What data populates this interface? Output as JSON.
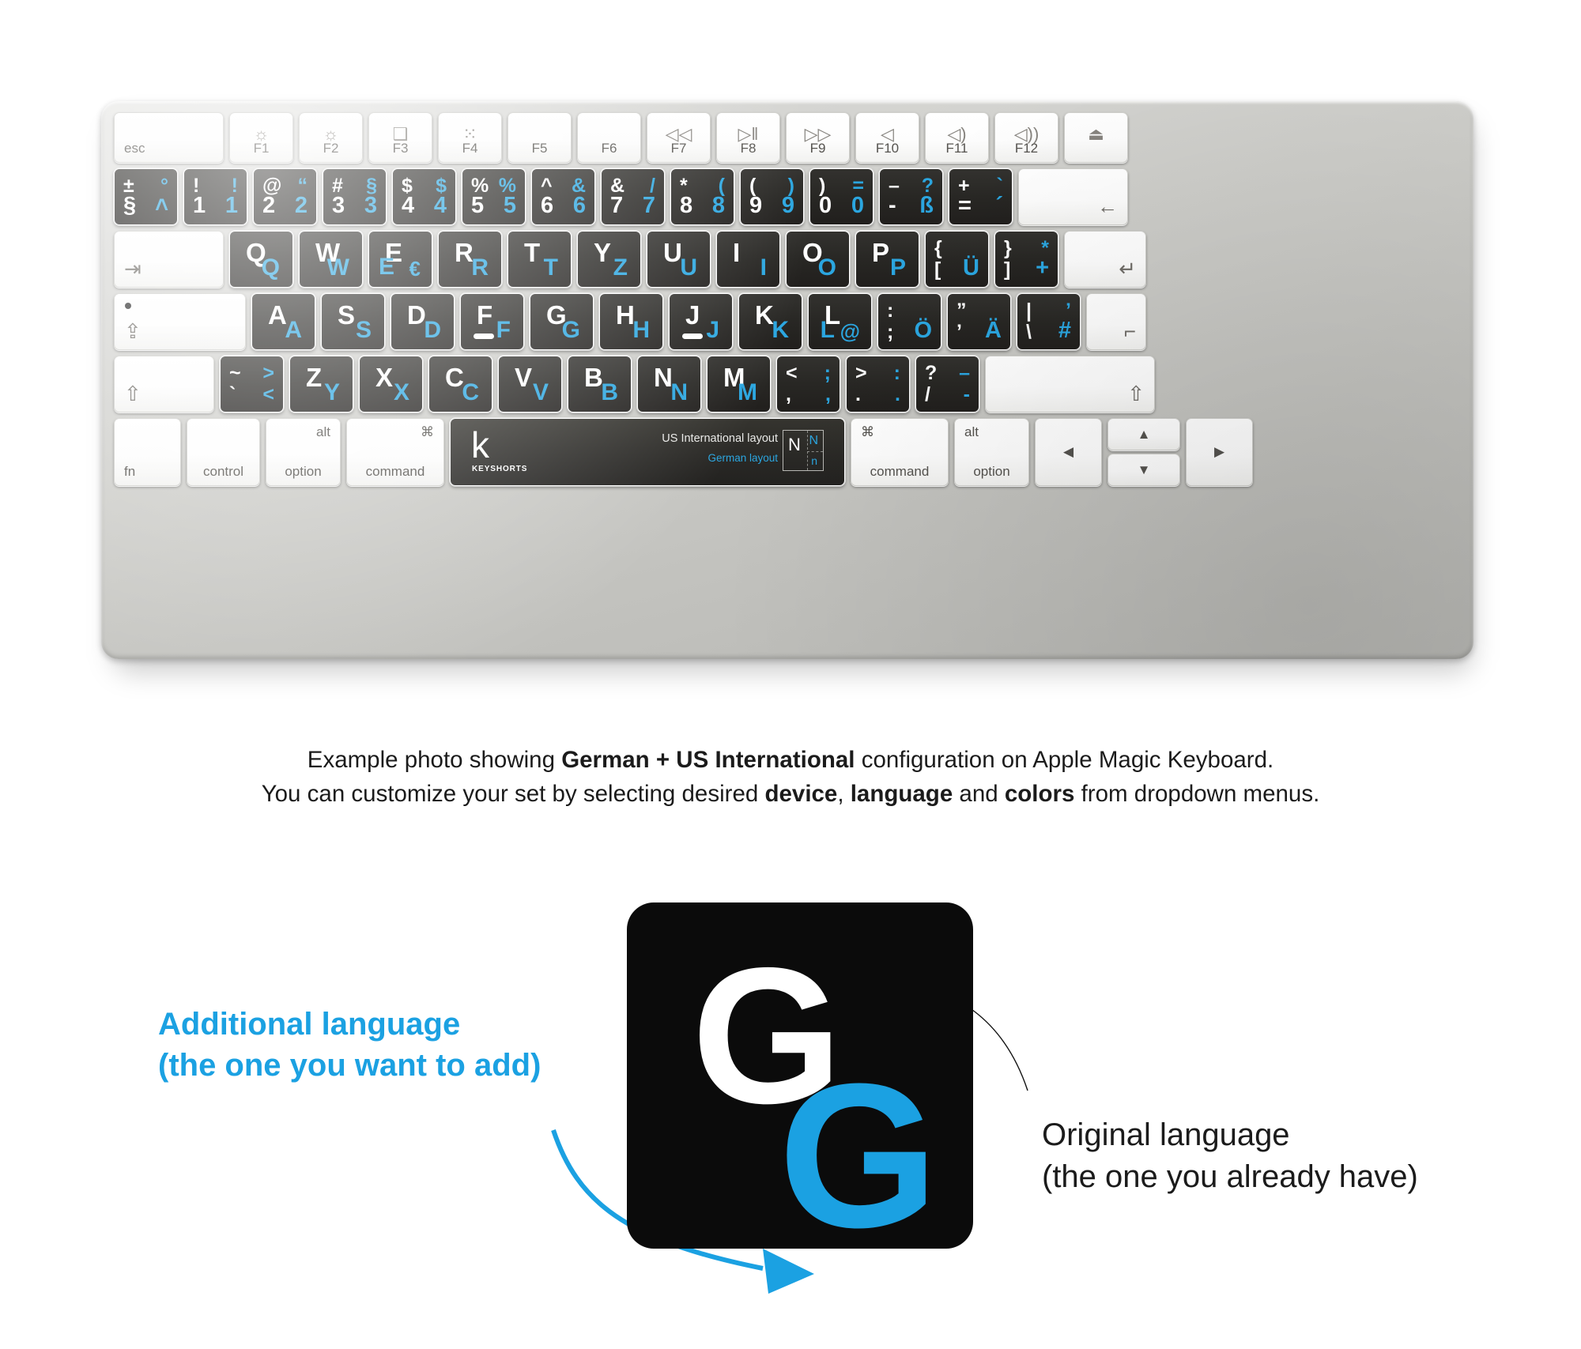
{
  "product": {
    "device": "Apple Magic Keyboard",
    "brand": "KEYSHORTS",
    "brand_mark": "k",
    "spacebar": {
      "primary_layout_label": "US International layout",
      "secondary_layout_label": "German layout",
      "badge": {
        "main": "N",
        "alt_top": "N",
        "alt_bottom": "n"
      }
    },
    "colors": {
      "accent_blue": "#2ba6e0",
      "key_black": "#262522",
      "key_white": "#ffffff",
      "body_silver": "#c9c9c5"
    }
  },
  "keyboard": {
    "function_row": [
      {
        "name": "esc",
        "type": "light",
        "label": "esc",
        "align": "bl",
        "width": 139
      },
      {
        "name": "f1",
        "type": "light",
        "label": "F1",
        "icon": "brightness-down-icon",
        "glyph": "☼"
      },
      {
        "name": "f2",
        "type": "light",
        "label": "F2",
        "icon": "brightness-up-icon",
        "glyph": "☼"
      },
      {
        "name": "f3",
        "type": "light",
        "label": "F3",
        "icon": "mission-control-icon",
        "glyph": "❑"
      },
      {
        "name": "f4",
        "type": "light",
        "label": "F4",
        "icon": "launchpad-icon",
        "glyph": "⁙"
      },
      {
        "name": "f5",
        "type": "light",
        "label": "F5",
        "icon": "none",
        "glyph": ""
      },
      {
        "name": "f6",
        "type": "light",
        "label": "F6",
        "icon": "none",
        "glyph": ""
      },
      {
        "name": "f7",
        "type": "light",
        "label": "F7",
        "icon": "rewind-icon",
        "glyph": "◁◁"
      },
      {
        "name": "f8",
        "type": "light",
        "label": "F8",
        "icon": "play-pause-icon",
        "glyph": "▷‖"
      },
      {
        "name": "f9",
        "type": "light",
        "label": "F9",
        "icon": "fast-forward-icon",
        "glyph": "▷▷"
      },
      {
        "name": "f10",
        "type": "light",
        "label": "F10",
        "icon": "mute-icon",
        "glyph": "◁"
      },
      {
        "name": "f11",
        "type": "light",
        "label": "F11",
        "icon": "volume-down-icon",
        "glyph": "◁)"
      },
      {
        "name": "f12",
        "type": "light",
        "label": "F12",
        "icon": "volume-up-icon",
        "glyph": "◁))"
      },
      {
        "name": "eject",
        "type": "light",
        "label": "",
        "icon": "eject-icon",
        "glyph": "⏏"
      }
    ],
    "number_row": [
      {
        "name": "key-grave",
        "tl": "±",
        "tr": "°",
        "bl": "§",
        "br": "˄"
      },
      {
        "name": "key-1",
        "tl": "!",
        "tr": "!",
        "bl": "1",
        "br": "1"
      },
      {
        "name": "key-2",
        "tl": "@",
        "tr": "“",
        "bl": "2",
        "br": "2"
      },
      {
        "name": "key-3",
        "tl": "#",
        "tr": "§",
        "bl": "3",
        "br": "3"
      },
      {
        "name": "key-4",
        "tl": "$",
        "tr": "$",
        "bl": "4",
        "br": "4"
      },
      {
        "name": "key-5",
        "tl": "%",
        "tr": "%",
        "bl": "5",
        "br": "5"
      },
      {
        "name": "key-6",
        "tl": "^",
        "tr": "&",
        "bl": "6",
        "br": "6"
      },
      {
        "name": "key-7",
        "tl": "&",
        "tr": "/",
        "bl": "7",
        "br": "7"
      },
      {
        "name": "key-8",
        "tl": "*",
        "tr": "(",
        "bl": "8",
        "br": "8"
      },
      {
        "name": "key-9",
        "tl": "(",
        "tr": ")",
        "bl": "9",
        "br": "9"
      },
      {
        "name": "key-0",
        "tl": ")",
        "tr": "=",
        "bl": "0",
        "br": "0"
      },
      {
        "name": "key-minus",
        "tl": "–",
        "tr": "?",
        "bl": "-",
        "br": "ß"
      },
      {
        "name": "key-equals",
        "tl": "+",
        "tr": "`",
        "bl": "=",
        "br": "´"
      },
      {
        "name": "key-delete",
        "type": "light",
        "glyph": "←",
        "align": "br"
      }
    ],
    "qwerty_row": [
      {
        "name": "key-tab",
        "type": "light",
        "glyph": "⇥",
        "align": "bl"
      },
      {
        "name": "key-q",
        "main": "Q",
        "sub": "Q"
      },
      {
        "name": "key-w",
        "main": "W",
        "sub": "W"
      },
      {
        "name": "key-e",
        "main": "E",
        "sub": "E",
        "extra": "€"
      },
      {
        "name": "key-r",
        "main": "R",
        "sub": "R"
      },
      {
        "name": "key-t",
        "main": "T",
        "sub": "T"
      },
      {
        "name": "key-y",
        "main": "Y",
        "sub": "Z"
      },
      {
        "name": "key-u",
        "main": "U",
        "sub": "U"
      },
      {
        "name": "key-i",
        "main": "I",
        "sub": "I"
      },
      {
        "name": "key-o",
        "main": "O",
        "sub": "O"
      },
      {
        "name": "key-p",
        "main": "P",
        "sub": "P"
      },
      {
        "name": "key-lbracket",
        "tl": "{",
        "bl": "[",
        "br": "Ü"
      },
      {
        "name": "key-rbracket",
        "tl": "}",
        "tr": "*",
        "bl": "]",
        "br": "+"
      },
      {
        "name": "key-return",
        "type": "light",
        "glyph": "↵",
        "align": "br"
      }
    ],
    "home_row": [
      {
        "name": "key-capslock",
        "type": "light",
        "glyph": "⇪",
        "align": "bl",
        "dot": true
      },
      {
        "name": "key-a",
        "main": "A",
        "sub": "A"
      },
      {
        "name": "key-s",
        "main": "S",
        "sub": "S"
      },
      {
        "name": "key-d",
        "main": "D",
        "sub": "D"
      },
      {
        "name": "key-f",
        "main": "F",
        "sub": "F",
        "homebar": true
      },
      {
        "name": "key-g",
        "main": "G",
        "sub": "G"
      },
      {
        "name": "key-h",
        "main": "H",
        "sub": "H"
      },
      {
        "name": "key-j",
        "main": "J",
        "sub": "J",
        "homebar": true
      },
      {
        "name": "key-k",
        "main": "K",
        "sub": "K"
      },
      {
        "name": "key-l",
        "main": "L",
        "sub": "L",
        "extra": "@"
      },
      {
        "name": "key-semicolon",
        "tl": ":",
        "bl": ";",
        "br": "Ö"
      },
      {
        "name": "key-quote",
        "tl": "”",
        "bl": "’",
        "br": "Ä"
      },
      {
        "name": "key-backslash",
        "tl": "|",
        "tr": "’",
        "bl": "\\",
        "br": "#"
      },
      {
        "name": "key-return-lower",
        "type": "light",
        "glyph": "⌐",
        "align": "br"
      }
    ],
    "bottom_letter_row": [
      {
        "name": "key-lshift",
        "type": "light",
        "glyph": "⇧",
        "align": "bl"
      },
      {
        "name": "key-section",
        "tl": "~",
        "tr": ">",
        "bl": "`",
        "br": "<"
      },
      {
        "name": "key-z",
        "main": "Z",
        "sub": "Y"
      },
      {
        "name": "key-x",
        "main": "X",
        "sub": "X"
      },
      {
        "name": "key-c",
        "main": "C",
        "sub": "C"
      },
      {
        "name": "key-v",
        "main": "V",
        "sub": "V"
      },
      {
        "name": "key-b",
        "main": "B",
        "sub": "B"
      },
      {
        "name": "key-n",
        "main": "N",
        "sub": "N"
      },
      {
        "name": "key-m",
        "main": "M",
        "sub": "M"
      },
      {
        "name": "key-comma",
        "tl": "<",
        "tr": ";",
        "bl": ",",
        "br": ","
      },
      {
        "name": "key-period",
        "tl": ">",
        "tr": ":",
        "bl": ".",
        "br": "."
      },
      {
        "name": "key-slash",
        "tl": "?",
        "tr": "–",
        "bl": "/",
        "br": "-"
      },
      {
        "name": "key-rshift",
        "type": "light",
        "glyph": "⇧",
        "align": "br"
      }
    ],
    "modifier_row": [
      {
        "name": "key-fn",
        "label": "fn"
      },
      {
        "name": "key-control",
        "label": "control"
      },
      {
        "name": "key-loption",
        "label": "option",
        "top": "alt"
      },
      {
        "name": "key-lcommand",
        "label": "command",
        "top": "⌘"
      },
      {
        "name": "key-rcommand",
        "label": "command",
        "top": "⌘"
      },
      {
        "name": "key-roption",
        "label": "option",
        "top": "alt"
      }
    ],
    "arrow_keys": {
      "left": "◀",
      "up": "▲",
      "down": "▼",
      "right": "▶"
    }
  },
  "caption": {
    "line1_a": "Example photo showing ",
    "line1_bold1": "German + US International",
    "line1_b": " configuration on Apple Magic Keyboard.",
    "line2_a": "You can customize your set by selecting desired ",
    "line2_bold1": "device",
    "line2_b": ", ",
    "line2_bold2": "language",
    "line2_c": " and ",
    "line2_bold3": "colors",
    "line2_d": " from dropdown menus."
  },
  "infographic": {
    "key_sample": {
      "white_letter": "G",
      "blue_letter": "G"
    },
    "additional_label_line1": "Additional language",
    "additional_label_line2": "(the one you want to add)",
    "original_label_line1": "Original language",
    "original_label_line2": "(the one you already have)"
  }
}
